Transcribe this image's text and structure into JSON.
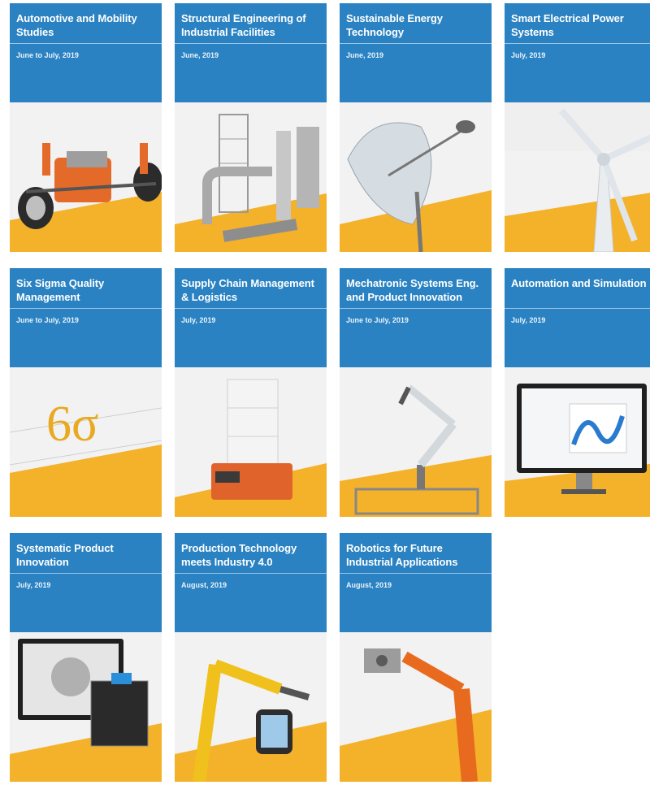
{
  "cards": [
    {
      "title": "Automotive and Mobility\nStudies",
      "date": "June to July, 2019",
      "illustration": "car-chassis-illustration"
    },
    {
      "title": "Structural Engineering of\nIndustrial Facilities",
      "date": "June, 2019",
      "illustration": "industrial-plant-illustration"
    },
    {
      "title": "Sustainable Energy\nTechnology",
      "date": "June, 2019",
      "illustration": "solar-dish-illustration"
    },
    {
      "title": "Smart Electrical Power\nSystems",
      "date": "July, 2019",
      "illustration": "wind-turbine-illustration"
    },
    {
      "title": "Six Sigma Quality\nManagement",
      "date": "June to July, 2019",
      "illustration": "six-sigma-illustration"
    },
    {
      "title": "Supply Chain Management\n& Logistics",
      "date": "July, 2019",
      "illustration": "logistics-robot-illustration"
    },
    {
      "title": "Mechatronic Systems Eng.\nand Product Innovation",
      "date": "June to July, 2019",
      "illustration": "robot-arm-illustration"
    },
    {
      "title": "Automation and Simulation",
      "date": "July, 2019",
      "illustration": "monitor-simulation-illustration"
    },
    {
      "title": "Systematic Product\nInnovation",
      "date": "July, 2019",
      "illustration": "cad-workstation-illustration"
    },
    {
      "title": "Production Technology\nmeets Industry 4.0",
      "date": "August, 2019",
      "illustration": "industrial-robot-tablet-illustration"
    },
    {
      "title": "Robotics for Future\nIndustrial Applications",
      "date": "August, 2019",
      "illustration": "orange-robot-illustration"
    }
  ],
  "colors": {
    "header_blue": "#2a82c2",
    "accent_yellow": "#f4b12a",
    "background": "#ffffff"
  }
}
